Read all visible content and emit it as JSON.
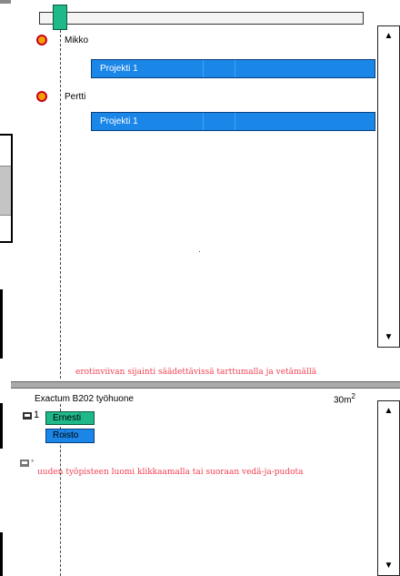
{
  "people": [
    {
      "name": "Mikko",
      "projects": [
        {
          "label": "Projekti 1"
        }
      ]
    },
    {
      "name": "Pertti",
      "projects": [
        {
          "label": "Projekti 1"
        }
      ]
    }
  ],
  "scroll_arrows": {
    "up": "▲",
    "down": "▼"
  },
  "divider_hint": "erotinviivan sijainti säädettävissä tarttumalla ja vetämällä",
  "room": {
    "title": "Exactum B202 työhuone",
    "area": "30m",
    "area_exp": "2",
    "workstations": [
      {
        "number": "1",
        "occupants": [
          "Ernesti",
          "Roisto"
        ]
      }
    ],
    "new_workstation_mark": "*",
    "new_workstation_hint": "uuden työpisteen luomi klikkaamalla tai suoraan vedä-ja-pudota"
  },
  "colors": {
    "project_bar": "#1a86e8",
    "slider_thumb": "#1fb889",
    "hint_text": "#f04050",
    "divider": "#a9a9a9"
  },
  "icons": {
    "person": "person-icon",
    "workstation": "computer-icon"
  }
}
